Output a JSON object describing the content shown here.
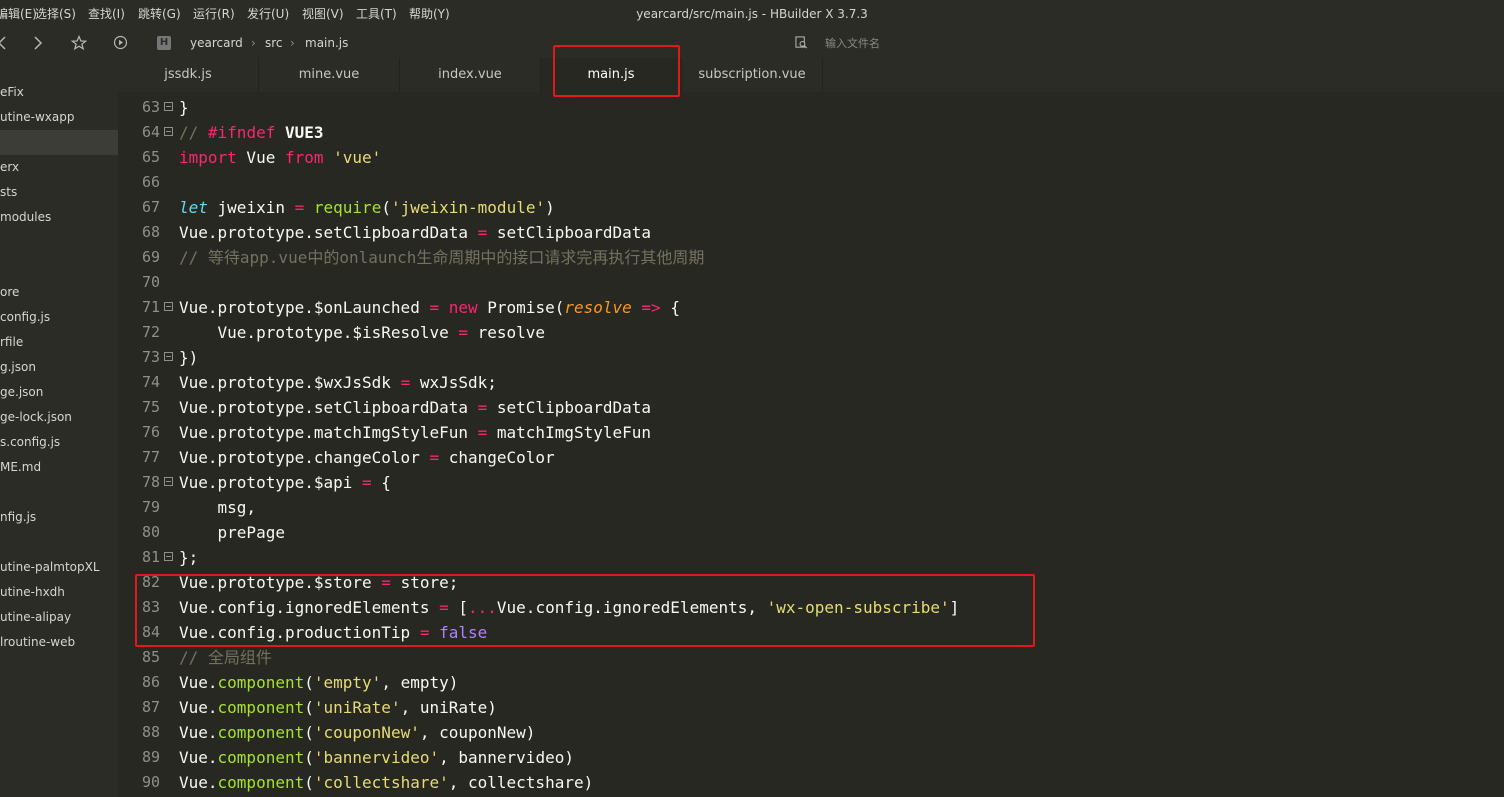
{
  "window": {
    "title": "yearcard/src/main.js - HBuilder X 3.7.3"
  },
  "menu": [
    "编辑(E)",
    "选择(S)",
    "查找(I)",
    "跳转(G)",
    "运行(R)",
    "发行(U)",
    "视图(V)",
    "工具(T)",
    "帮助(Y)"
  ],
  "toolbar": {
    "breadcrumb": [
      "yearcard",
      "src",
      "main.js"
    ],
    "search_placeholder": "输入文件名"
  },
  "sidebar": {
    "items": [
      "eFix",
      "utine-wxapp",
      "",
      "erx",
      "sts",
      "modules",
      "",
      "",
      "ore",
      "config.js",
      "rfile",
      "g.json",
      "ge.json",
      "ge-lock.json",
      "s.config.js",
      "ME.md",
      "",
      "nfig.js",
      "",
      "utine-palmtopXL",
      "utine-hxdh",
      "utine-alipay",
      "lroutine-web"
    ]
  },
  "tabs": [
    "jssdk.js",
    "mine.vue",
    "index.vue",
    "main.js",
    "subscription.vue"
  ],
  "active_tab": "main.js",
  "code_lines": [
    {
      "n": "63",
      "fold": true,
      "tokens": [
        [
          "p",
          "}"
        ]
      ]
    },
    {
      "n": "64",
      "fold": true,
      "tokens": [
        [
          "cm",
          "// "
        ],
        [
          "kw",
          "#ifndef"
        ],
        [
          "p",
          " "
        ],
        [
          "dir",
          "VUE3"
        ]
      ]
    },
    {
      "n": "65",
      "fold": false,
      "tokens": [
        [
          "kw",
          "import"
        ],
        [
          "p",
          " Vue "
        ],
        [
          "kw",
          "from"
        ],
        [
          "p",
          " "
        ],
        [
          "str",
          "'vue'"
        ]
      ]
    },
    {
      "n": "66",
      "fold": false,
      "tokens": []
    },
    {
      "n": "67",
      "fold": false,
      "tokens": [
        [
          "kw2",
          "let"
        ],
        [
          "p",
          " jweixin "
        ],
        [
          "op",
          "="
        ],
        [
          "p",
          " "
        ],
        [
          "fn",
          "require"
        ],
        [
          "p",
          "("
        ],
        [
          "str",
          "'jweixin-module'"
        ],
        [
          "p",
          ")"
        ]
      ]
    },
    {
      "n": "68",
      "fold": false,
      "tokens": [
        [
          "p",
          "Vue.prototype.setClipboardData "
        ],
        [
          "op",
          "="
        ],
        [
          "p",
          " setClipboardData"
        ]
      ]
    },
    {
      "n": "69",
      "fold": false,
      "tokens": [
        [
          "cm",
          "// 等待app.vue中的onlaunch生命周期中的接口请求完再执行其他周期"
        ]
      ]
    },
    {
      "n": "70",
      "fold": false,
      "tokens": []
    },
    {
      "n": "71",
      "fold": true,
      "tokens": [
        [
          "p",
          "Vue.prototype.$onLaunched "
        ],
        [
          "op",
          "="
        ],
        [
          "p",
          " "
        ],
        [
          "kw",
          "new"
        ],
        [
          "p",
          " Promise("
        ],
        [
          "par",
          "resolve"
        ],
        [
          "p",
          " "
        ],
        [
          "op",
          "=>"
        ],
        [
          "p",
          " {"
        ]
      ]
    },
    {
      "n": "72",
      "fold": false,
      "tokens": [
        [
          "p",
          "    Vue.prototype.$isResolve "
        ],
        [
          "op",
          "="
        ],
        [
          "p",
          " resolve"
        ]
      ]
    },
    {
      "n": "73",
      "fold": true,
      "tokens": [
        [
          "p",
          "})"
        ]
      ]
    },
    {
      "n": "74",
      "fold": false,
      "tokens": [
        [
          "p",
          "Vue.prototype.$wxJsSdk "
        ],
        [
          "op",
          "="
        ],
        [
          "p",
          " wxJsSdk;"
        ]
      ]
    },
    {
      "n": "75",
      "fold": false,
      "tokens": [
        [
          "p",
          "Vue.prototype.setClipboardData "
        ],
        [
          "op",
          "="
        ],
        [
          "p",
          " setClipboardData"
        ]
      ]
    },
    {
      "n": "76",
      "fold": false,
      "tokens": [
        [
          "p",
          "Vue.prototype.matchImgStyleFun "
        ],
        [
          "op",
          "="
        ],
        [
          "p",
          " matchImgStyleFun"
        ]
      ]
    },
    {
      "n": "77",
      "fold": false,
      "tokens": [
        [
          "p",
          "Vue.prototype.changeColor "
        ],
        [
          "op",
          "="
        ],
        [
          "p",
          " changeColor"
        ]
      ]
    },
    {
      "n": "78",
      "fold": true,
      "tokens": [
        [
          "p",
          "Vue.prototype.$api "
        ],
        [
          "op",
          "="
        ],
        [
          "p",
          " {"
        ]
      ]
    },
    {
      "n": "79",
      "fold": false,
      "tokens": [
        [
          "p",
          "    msg,"
        ]
      ]
    },
    {
      "n": "80",
      "fold": false,
      "tokens": [
        [
          "p",
          "    prePage"
        ]
      ]
    },
    {
      "n": "81",
      "fold": true,
      "tokens": [
        [
          "p",
          "};"
        ]
      ]
    },
    {
      "n": "82",
      "fold": false,
      "tokens": [
        [
          "p",
          "Vue.prototype.$store "
        ],
        [
          "op",
          "="
        ],
        [
          "p",
          " store;"
        ]
      ]
    },
    {
      "n": "83",
      "fold": false,
      "tokens": [
        [
          "p",
          "Vue.config.ignoredElements "
        ],
        [
          "op",
          "="
        ],
        [
          "p",
          " ["
        ],
        [
          "op",
          "..."
        ],
        [
          "p",
          "Vue.config.ignoredElements, "
        ],
        [
          "str",
          "'wx-open-subscribe'"
        ],
        [
          "p",
          "]"
        ]
      ]
    },
    {
      "n": "84",
      "fold": false,
      "tokens": [
        [
          "p",
          "Vue.config.productionTip "
        ],
        [
          "op",
          "="
        ],
        [
          "p",
          " "
        ],
        [
          "bool",
          "false"
        ]
      ]
    },
    {
      "n": "85",
      "fold": false,
      "tokens": [
        [
          "cm",
          "// 全局组件"
        ]
      ]
    },
    {
      "n": "86",
      "fold": false,
      "tokens": [
        [
          "p",
          "Vue."
        ],
        [
          "fn",
          "component"
        ],
        [
          "p",
          "("
        ],
        [
          "str",
          "'empty'"
        ],
        [
          "p",
          ", empty)"
        ]
      ]
    },
    {
      "n": "87",
      "fold": false,
      "tokens": [
        [
          "p",
          "Vue."
        ],
        [
          "fn",
          "component"
        ],
        [
          "p",
          "("
        ],
        [
          "str",
          "'uniRate'"
        ],
        [
          "p",
          ", uniRate)"
        ]
      ]
    },
    {
      "n": "88",
      "fold": false,
      "tokens": [
        [
          "p",
          "Vue."
        ],
        [
          "fn",
          "component"
        ],
        [
          "p",
          "("
        ],
        [
          "str",
          "'couponNew'"
        ],
        [
          "p",
          ", couponNew)"
        ]
      ]
    },
    {
      "n": "89",
      "fold": false,
      "tokens": [
        [
          "p",
          "Vue."
        ],
        [
          "fn",
          "component"
        ],
        [
          "p",
          "("
        ],
        [
          "str",
          "'bannervideo'"
        ],
        [
          "p",
          ", bannervideo)"
        ]
      ]
    },
    {
      "n": "90",
      "fold": false,
      "tokens": [
        [
          "p",
          "Vue."
        ],
        [
          "fn",
          "component"
        ],
        [
          "p",
          "("
        ],
        [
          "str",
          "'collectshare'"
        ],
        [
          "p",
          ", collectshare)"
        ]
      ]
    }
  ],
  "colors": {
    "background": "#272822",
    "chrome": "#2b2c26",
    "annotation": "#e0191b",
    "keyword": "#f92672",
    "string": "#e6db74",
    "comment": "#75715e",
    "function": "#a6e22e"
  },
  "icons": [
    "back-icon",
    "forward-icon",
    "star-icon",
    "run-icon",
    "hbuilder-logo-icon",
    "file-search-icon",
    "fold-icon"
  ]
}
